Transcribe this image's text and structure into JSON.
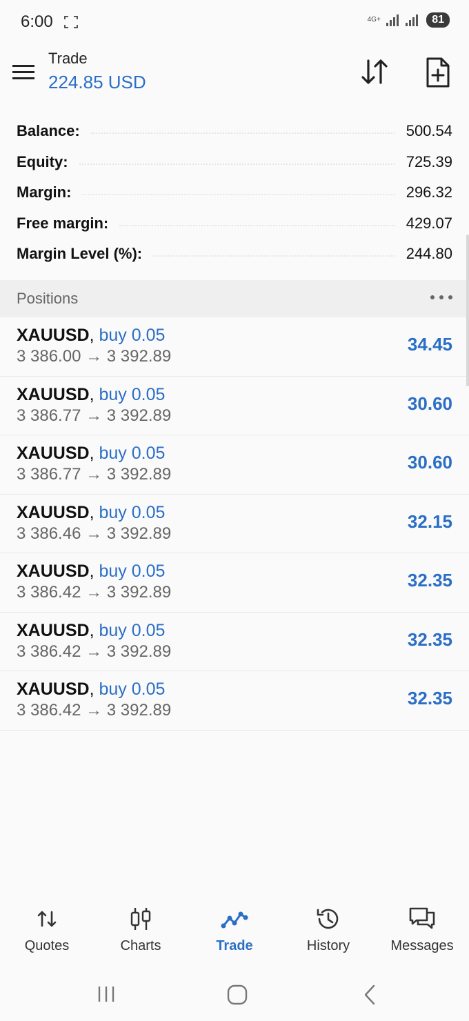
{
  "status_bar": {
    "time": "6:00",
    "network": "4G+",
    "battery": "81"
  },
  "app_bar": {
    "title": "Trade",
    "subtitle": "224.85 USD"
  },
  "summary": [
    {
      "label": "Balance:",
      "value": "500.54"
    },
    {
      "label": "Equity:",
      "value": "725.39"
    },
    {
      "label": "Margin:",
      "value": "296.32"
    },
    {
      "label": "Free margin:",
      "value": "429.07"
    },
    {
      "label": "Margin Level (%):",
      "value": "244.80"
    }
  ],
  "positions": {
    "title": "Positions",
    "items": [
      {
        "symbol": "XAUUSD",
        "side": "buy 0.05",
        "prices": "3 386.00 → 3 392.89",
        "profit": "34.45"
      },
      {
        "symbol": "XAUUSD",
        "side": "buy 0.05",
        "prices": "3 386.77 → 3 392.89",
        "profit": "30.60"
      },
      {
        "symbol": "XAUUSD",
        "side": "buy 0.05",
        "prices": "3 386.77 → 3 392.89",
        "profit": "30.60"
      },
      {
        "symbol": "XAUUSD",
        "side": "buy 0.05",
        "prices": "3 386.46 → 3 392.89",
        "profit": "32.15"
      },
      {
        "symbol": "XAUUSD",
        "side": "buy 0.05",
        "prices": "3 386.42 → 3 392.89",
        "profit": "32.35"
      },
      {
        "symbol": "XAUUSD",
        "side": "buy 0.05",
        "prices": "3 386.42 → 3 392.89",
        "profit": "32.35"
      },
      {
        "symbol": "XAUUSD",
        "side": "buy 0.05",
        "prices": "3 386.42 → 3 392.89",
        "profit": "32.35"
      }
    ]
  },
  "bottom_nav": [
    {
      "label": "Quotes",
      "icon": "quotes-icon"
    },
    {
      "label": "Charts",
      "icon": "charts-icon"
    },
    {
      "label": "Trade",
      "icon": "trade-icon"
    },
    {
      "label": "History",
      "icon": "history-icon"
    },
    {
      "label": "Messages",
      "icon": "messages-icon"
    }
  ],
  "active_tab": "Trade",
  "colors": {
    "accent": "#2a6ec6",
    "text": "#111111",
    "muted": "#666666"
  }
}
